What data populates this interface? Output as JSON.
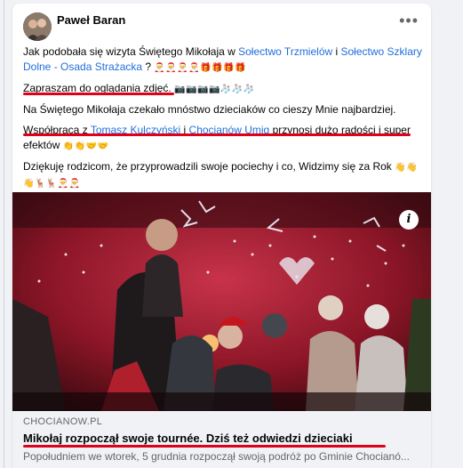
{
  "post": {
    "author": "Paweł Baran",
    "more_label": "•••",
    "p1_a": "Jak podobała się wizyta Świętego Mikołaja w ",
    "p1_link1": "Sołectwo Trzmielów",
    "p1_b": " i ",
    "p1_link2": "Sołectwo Szklary Dolne - Osada Strażacka",
    "p1_c": " ? ",
    "p1_emoji": "🎅🎅🎅🎅🎁🎁🎁🎁",
    "p2": "Zapraszam do oglądania zdjęć. ",
    "p2_emoji": "📷📷📷📷🧦🧦🧦",
    "p3": "Na Świętego Mikołaja czekało mnóstwo dzieciaków co cieszy Mnie najbardziej.",
    "p4_a": "Współpraca z ",
    "p4_link1": "Tomasz Kulczyński",
    "p4_b": " i ",
    "p4_link2": "Chocianów Umig",
    "p4_c": " przynosi dużo radości i super efektów ",
    "p4_emoji": "👏👏🤝🤝",
    "p5": "Dziękuję rodzicom, że przyprowadzili swoje pociechy  i co, Widzimy się za Rok ",
    "p5_emoji": "👋👋👋🦌🦌🎅🎅"
  },
  "link_preview": {
    "info_icon": "i",
    "domain": "CHOCIANOW.PL",
    "title": "Mikołaj rozpoczął swoje tournée. Dziś też odwiedzi dzieciaki",
    "description": "Popołudniem we wtorek, 5 grudnia rozpoczął swoją podróż po Gminie Chocianó..."
  },
  "colors": {
    "link": "#216fdb",
    "highlight": "#e0001b",
    "photo_bg": "#7a1220"
  },
  "icons": [
    "avatar",
    "more-options-icon",
    "info-icon"
  ]
}
